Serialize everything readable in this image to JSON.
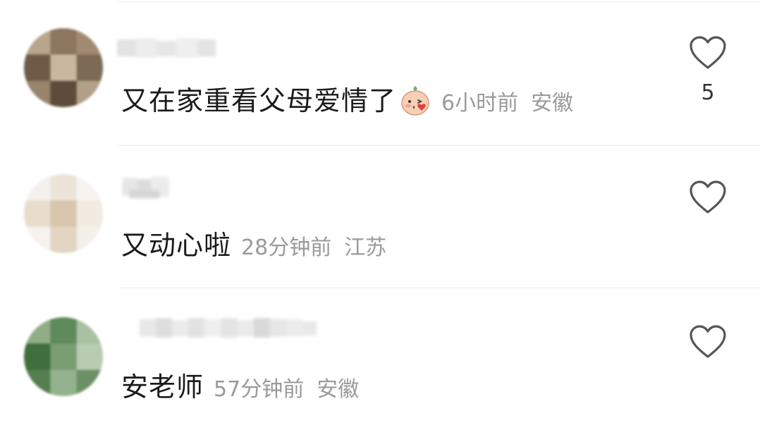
{
  "comments": [
    {
      "text": "又在家重看父母爱情了",
      "emoji": "cute-kiss-emoji",
      "time": "6小时前",
      "location": "安徽",
      "likes": "5",
      "avatar_colors": [
        "#b9a58c",
        "#8c7660",
        "#a08a70",
        "#6e5a46",
        "#c9b79f",
        "#7d6a55",
        "#98846b",
        "#5e4c3a",
        "#b3a088"
      ]
    },
    {
      "text": "又动心啦",
      "time": "28分钟前",
      "location": "江苏",
      "likes": "",
      "avatar_colors": [
        "#f4f1ec",
        "#ece4d8",
        "#f7f4ef",
        "#e8dccb",
        "#d8c6ae",
        "#f1ebe2",
        "#f6f3ee",
        "#e2d5c2",
        "#f3efe9"
      ]
    },
    {
      "text": "安老师",
      "time": "57分钟前",
      "location": "安徽",
      "likes": "",
      "avatar_colors": [
        "#8fae86",
        "#5f8a5a",
        "#a9c1a0",
        "#3f6f3c",
        "#7a9d74",
        "#b7ccb1",
        "#557f50",
        "#94b28d",
        "#6c9066"
      ]
    }
  ],
  "colors": {
    "text": "#1a1a1a",
    "meta": "#9a9a9a",
    "divider": "#ececec",
    "heart": "#555555"
  },
  "icons": {
    "like": "heart-outline-icon"
  }
}
